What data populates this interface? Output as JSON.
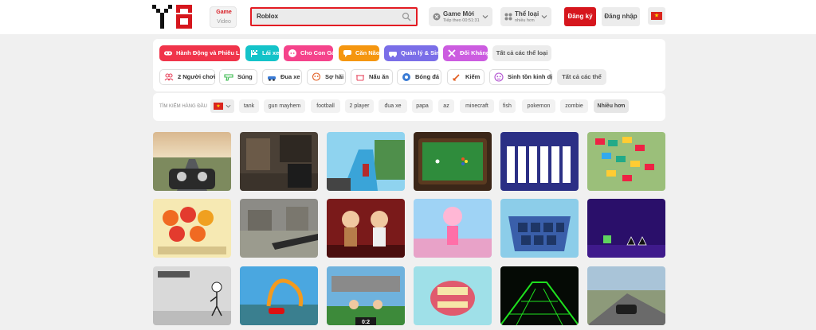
{
  "header": {
    "logo_text": "Y8",
    "switch": {
      "active": "Game",
      "inactive": "Video"
    },
    "search": {
      "value": "Roblox"
    },
    "new_games": {
      "title": "Game Mới",
      "subtitle": "Tiếp theo 00:51:31"
    },
    "categories_menu": {
      "title": "Thể loại",
      "subtitle": "nhiều hơn"
    },
    "signup_label": "Đăng ký",
    "login_label": "Đăng nhập",
    "language_flag": "vietnam-flag-icon"
  },
  "categories": [
    {
      "label": "Hành Động và Phiêu Lưu",
      "color": "#f0344a",
      "icon": "gamepad-icon"
    },
    {
      "label": "Lái xe",
      "color": "#14c3c9",
      "icon": "checkered-flag-icon"
    },
    {
      "label": "Cho Con Gái",
      "color": "#f5438b",
      "icon": "girl-face-icon"
    },
    {
      "label": "Căn Não",
      "color": "#f5960f",
      "icon": "speech-bubble-icon"
    },
    {
      "label": "Quản lý & Sim",
      "color": "#7a6ee8",
      "icon": "car-sim-icon"
    },
    {
      "label": "Đối Kháng",
      "color": "#cc5ce0",
      "icon": "crossed-swords-icon"
    }
  ],
  "categories_all_label": "Tất cả các thể loại",
  "tags": [
    {
      "label": "2 Người chơi",
      "icon": "two-players-icon"
    },
    {
      "label": "Súng",
      "icon": "gun-icon"
    },
    {
      "label": "Đua xe",
      "icon": "race-car-icon"
    },
    {
      "label": "Sợ hãi",
      "icon": "skull-icon"
    },
    {
      "label": "Nấu ăn",
      "icon": "cooking-pot-icon"
    },
    {
      "label": "Bóng đá",
      "icon": "soccer-ball-icon"
    },
    {
      "label": "Kiếm",
      "icon": "sword-icon"
    },
    {
      "label": "Sinh tồn kinh dị",
      "icon": "zombie-face-icon"
    }
  ],
  "tags_all_label": "Tất cả các thể",
  "top_searches": {
    "label": "TÌM KIẾM HÀNG ĐẦU",
    "keywords": [
      "tank",
      "gun mayhem",
      "football",
      "2 player",
      "đua xe",
      "papa",
      "az",
      "minecraft",
      "fish",
      "pokemon",
      "zombie"
    ],
    "more_label": "Nhiều hơn"
  },
  "game_grid": {
    "thumbnails": [
      "motorbike-road-thumbnail",
      "fps-warehouse-thumbnail",
      "blue-obstacle-course-thumbnail",
      "billiards-table-thumbnail",
      "solitaire-cards-thumbnail",
      "car-parking-jam-thumbnail",
      "fruit-faces-thumbnail",
      "sniper-rifle-thumbnail",
      "cartoon-men-stage-thumbnail",
      "anime-dressup-thumbnail",
      "tile-match-board-thumbnail",
      "geometry-dash-thumbnail",
      "stickman-escape-thumbnail",
      "stunt-loop-car-thumbnail",
      "soccer-heads-thumbnail",
      "dentist-teeth-thumbnail",
      "neon-tunnel-thumbnail",
      "highway-car-thumbnail"
    ],
    "soccer_score": "0:2"
  }
}
